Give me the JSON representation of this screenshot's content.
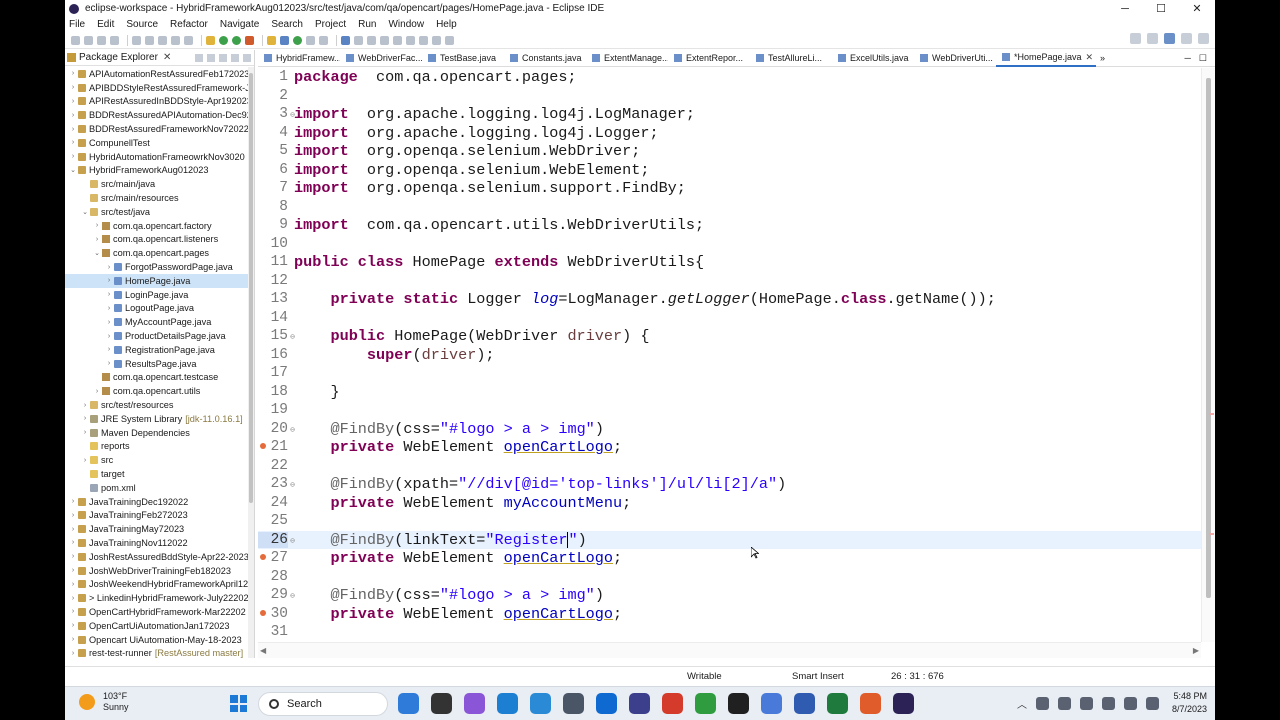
{
  "window": {
    "title": "eclipse-workspace - HybridFrameworkAug012023/src/test/java/com/qa/opencart/pages/HomePage.java - Eclipse IDE",
    "minimize": "─",
    "maximize": "☐",
    "close": "✕"
  },
  "menu": [
    "File",
    "Edit",
    "Source",
    "Refactor",
    "Navigate",
    "Search",
    "Project",
    "Run",
    "Window",
    "Help"
  ],
  "package_explorer": {
    "title": "Package Explorer",
    "items": [
      {
        "label": "APIAutomationRestAssuredFeb172023",
        "depth": 0,
        "icon": "proj",
        "tw": "›"
      },
      {
        "label": "APIBDDStyleRestAssuredFramework-Ju",
        "depth": 0,
        "icon": "proj",
        "tw": "›"
      },
      {
        "label": "APIRestAssuredInBDDStyle-Apr192023",
        "depth": 0,
        "icon": "proj",
        "tw": "›"
      },
      {
        "label": "BDDRestAssuredAPIAutomation-Dec92",
        "depth": 0,
        "icon": "proj",
        "tw": "›"
      },
      {
        "label": "BDDRestAssuredFrameworkNov72022",
        "depth": 0,
        "icon": "proj",
        "tw": "›"
      },
      {
        "label": "CompunellTest",
        "depth": 0,
        "icon": "proj",
        "tw": "›"
      },
      {
        "label": "HybridAutomationFrameowrkNov3020",
        "depth": 0,
        "icon": "proj",
        "tw": "›"
      },
      {
        "label": "HybridFrameworkAug012023",
        "depth": 0,
        "icon": "proj",
        "tw": "⌄"
      },
      {
        "label": "src/main/java",
        "depth": 1,
        "icon": "src",
        "tw": ""
      },
      {
        "label": "src/main/resources",
        "depth": 1,
        "icon": "src",
        "tw": ""
      },
      {
        "label": "src/test/java",
        "depth": 1,
        "icon": "src",
        "tw": "⌄"
      },
      {
        "label": "com.qa.opencart.factory",
        "depth": 2,
        "icon": "pkg",
        "tw": "›"
      },
      {
        "label": "com.qa.opencart.listeners",
        "depth": 2,
        "icon": "pkg",
        "tw": "›"
      },
      {
        "label": "com.qa.opencart.pages",
        "depth": 2,
        "icon": "pkg",
        "tw": "⌄"
      },
      {
        "label": "ForgotPasswordPage.java",
        "depth": 3,
        "icon": "java",
        "tw": "›"
      },
      {
        "label": "HomePage.java",
        "depth": 3,
        "icon": "java",
        "tw": "›",
        "selected": true
      },
      {
        "label": "LoginPage.java",
        "depth": 3,
        "icon": "java",
        "tw": "›"
      },
      {
        "label": "LogoutPage.java",
        "depth": 3,
        "icon": "java",
        "tw": "›"
      },
      {
        "label": "MyAccountPage.java",
        "depth": 3,
        "icon": "java",
        "tw": "›"
      },
      {
        "label": "ProductDetailsPage.java",
        "depth": 3,
        "icon": "java",
        "tw": "›"
      },
      {
        "label": "RegistrationPage.java",
        "depth": 3,
        "icon": "java",
        "tw": "›"
      },
      {
        "label": "ResultsPage.java",
        "depth": 3,
        "icon": "java",
        "tw": "›"
      },
      {
        "label": "com.qa.opencart.testcase",
        "depth": 2,
        "icon": "pkg",
        "tw": ""
      },
      {
        "label": "com.qa.opencart.utils",
        "depth": 2,
        "icon": "pkg",
        "tw": "›"
      },
      {
        "label": "src/test/resources",
        "depth": 1,
        "icon": "src",
        "tw": "›"
      },
      {
        "label": "JRE System Library",
        "depth": 1,
        "icon": "lib",
        "tw": "›",
        "decoration": "[jdk-11.0.16.1]"
      },
      {
        "label": "Maven Dependencies",
        "depth": 1,
        "icon": "lib",
        "tw": "›"
      },
      {
        "label": "reports",
        "depth": 1,
        "icon": "folder",
        "tw": ""
      },
      {
        "label": "src",
        "depth": 1,
        "icon": "folder",
        "tw": "›"
      },
      {
        "label": "target",
        "depth": 1,
        "icon": "folder",
        "tw": ""
      },
      {
        "label": "pom.xml",
        "depth": 1,
        "icon": "file",
        "tw": ""
      },
      {
        "label": "JavaTrainingDec192022",
        "depth": 0,
        "icon": "proj",
        "tw": "›"
      },
      {
        "label": "JavaTrainingFeb272023",
        "depth": 0,
        "icon": "proj",
        "tw": "›"
      },
      {
        "label": "JavaTrainingMay72023",
        "depth": 0,
        "icon": "proj",
        "tw": "›"
      },
      {
        "label": "JavaTrainingNov112022",
        "depth": 0,
        "icon": "proj",
        "tw": "›"
      },
      {
        "label": "JoshRestAssuredBddStyle-Apr22-2023",
        "depth": 0,
        "icon": "proj",
        "tw": "›"
      },
      {
        "label": "JoshWebDriverTrainingFeb182023",
        "depth": 0,
        "icon": "proj",
        "tw": "›"
      },
      {
        "label": "JoshWeekendHybridFrameworkApril12",
        "depth": 0,
        "icon": "proj",
        "tw": "›"
      },
      {
        "label": "> LinkedinHybridFramework-July22202",
        "depth": 0,
        "icon": "proj",
        "tw": "›"
      },
      {
        "label": "OpenCartHybridFramework-Mar22202",
        "depth": 0,
        "icon": "proj",
        "tw": "›"
      },
      {
        "label": "OpenCartUiAutomationJan172023",
        "depth": 0,
        "icon": "proj",
        "tw": "›"
      },
      {
        "label": "Opencart UiAutomation-May-18-2023",
        "depth": 0,
        "icon": "proj",
        "tw": "›"
      },
      {
        "label": "rest-test-runner",
        "depth": 0,
        "icon": "proj",
        "tw": "›",
        "decoration": "[RestAssured master]"
      }
    ]
  },
  "editor_tabs": [
    {
      "label": "HybridFramew...",
      "active": false
    },
    {
      "label": "WebDriverFac...",
      "active": false
    },
    {
      "label": "TestBase.java",
      "active": false
    },
    {
      "label": "Constants.java",
      "active": false
    },
    {
      "label": "ExtentManage...",
      "active": false
    },
    {
      "label": "ExtentRepor...",
      "active": false
    },
    {
      "label": "TestAllureLi...",
      "active": false
    },
    {
      "label": "ExcelUtils.java",
      "active": false
    },
    {
      "label": "WebDriverUti...",
      "active": false
    },
    {
      "label": "*HomePage.java",
      "active": true
    }
  ],
  "tab_overflow": "»",
  "code_lines": [
    {
      "n": "1",
      "tokens": [
        [
          "kw",
          "package"
        ],
        [
          "",
          "  com.qa.opencart.pages;"
        ]
      ]
    },
    {
      "n": "2",
      "tokens": []
    },
    {
      "n": "3",
      "fold": "⊖",
      "tokens": [
        [
          "kw",
          "import"
        ],
        [
          "",
          "  org.apache.logging.log4j.LogManager;"
        ]
      ]
    },
    {
      "n": "4",
      "tokens": [
        [
          "kw",
          "import"
        ],
        [
          "",
          "  org.apache.logging.log4j.Logger;"
        ]
      ]
    },
    {
      "n": "5",
      "tokens": [
        [
          "kw",
          "import"
        ],
        [
          "",
          "  org.openqa.selenium.WebDriver;"
        ]
      ]
    },
    {
      "n": "6",
      "tokens": [
        [
          "kw",
          "import"
        ],
        [
          "",
          "  org.openqa.selenium.WebElement;"
        ]
      ]
    },
    {
      "n": "7",
      "tokens": [
        [
          "kw",
          "import"
        ],
        [
          "",
          "  org.openqa.selenium.support.FindBy;"
        ]
      ]
    },
    {
      "n": "8",
      "tokens": []
    },
    {
      "n": "9",
      "tokens": [
        [
          "kw",
          "import"
        ],
        [
          "",
          "  com.qa.opencart.utils.WebDriverUtils;"
        ]
      ]
    },
    {
      "n": "10",
      "tokens": []
    },
    {
      "n": "11",
      "tokens": [
        [
          "kw",
          "public class"
        ],
        [
          "",
          " HomePage "
        ],
        [
          "kw",
          "extends"
        ],
        [
          "",
          " WebDriverUtils{"
        ]
      ]
    },
    {
      "n": "12",
      "tokens": []
    },
    {
      "n": "13",
      "tokens": [
        [
          "",
          "    "
        ],
        [
          "kw",
          "private static"
        ],
        [
          "",
          " Logger "
        ],
        [
          "fld2 ital",
          "log"
        ],
        [
          "",
          "=LogManager."
        ],
        [
          "ital",
          "getLogger"
        ],
        [
          "",
          "(HomePage."
        ],
        [
          "kw",
          "class"
        ],
        [
          "",
          ".getName());"
        ]
      ]
    },
    {
      "n": "14",
      "tokens": []
    },
    {
      "n": "15",
      "fold": "⊖",
      "tokens": [
        [
          "",
          "    "
        ],
        [
          "kw",
          "public"
        ],
        [
          "",
          " HomePage(WebDriver "
        ],
        [
          "param",
          "driver"
        ],
        [
          "",
          ") {"
        ]
      ]
    },
    {
      "n": "16",
      "tokens": [
        [
          "",
          "        "
        ],
        [
          "kw",
          "super"
        ],
        [
          "",
          "("
        ],
        [
          "param",
          "driver"
        ],
        [
          "",
          ");"
        ]
      ]
    },
    {
      "n": "17",
      "tokens": []
    },
    {
      "n": "18",
      "tokens": [
        [
          "",
          "    }"
        ]
      ]
    },
    {
      "n": "19",
      "tokens": []
    },
    {
      "n": "20",
      "fold": "⊖",
      "tokens": [
        [
          "",
          "    "
        ],
        [
          "ann",
          "@FindBy"
        ],
        [
          "",
          "(css="
        ],
        [
          "str",
          "\"#logo > a > img\""
        ],
        [
          "",
          ")"
        ]
      ]
    },
    {
      "n": "21",
      "err": true,
      "tokens": [
        [
          "",
          "    "
        ],
        [
          "kw",
          "private"
        ],
        [
          "",
          " WebElement "
        ],
        [
          "fld",
          "openCartLogo"
        ],
        [
          "",
          ";"
        ]
      ]
    },
    {
      "n": "22",
      "tokens": []
    },
    {
      "n": "23",
      "fold": "⊖",
      "tokens": [
        [
          "",
          "    "
        ],
        [
          "ann",
          "@FindBy"
        ],
        [
          "",
          "(xpath="
        ],
        [
          "str",
          "\"//div[@id='top-links']/ul/li[2]/a\""
        ],
        [
          "",
          ")"
        ]
      ]
    },
    {
      "n": "24",
      "tokens": [
        [
          "",
          "    "
        ],
        [
          "kw",
          "private"
        ],
        [
          "",
          " WebElement "
        ],
        [
          "fld2",
          "myAccountMenu"
        ],
        [
          "",
          ";"
        ]
      ]
    },
    {
      "n": "25",
      "tokens": []
    },
    {
      "n": "26",
      "current": true,
      "fold": "⊖",
      "tokens": [
        [
          "",
          "    "
        ],
        [
          "ann",
          "@FindBy"
        ],
        [
          "",
          "(linkText="
        ],
        [
          "str",
          "\"Register"
        ],
        [
          "caret",
          ""
        ],
        [
          "str",
          "\""
        ],
        [
          "",
          ")"
        ]
      ]
    },
    {
      "n": "27",
      "err": true,
      "tokens": [
        [
          "",
          "    "
        ],
        [
          "kw",
          "private"
        ],
        [
          "",
          " WebElement "
        ],
        [
          "fld",
          "openCartLogo"
        ],
        [
          "",
          ";"
        ]
      ]
    },
    {
      "n": "28",
      "tokens": []
    },
    {
      "n": "29",
      "fold": "⊖",
      "tokens": [
        [
          "",
          "    "
        ],
        [
          "ann",
          "@FindBy"
        ],
        [
          "",
          "(css="
        ],
        [
          "str",
          "\"#logo > a > img\""
        ],
        [
          "",
          ")"
        ]
      ]
    },
    {
      "n": "30",
      "err": true,
      "tokens": [
        [
          "",
          "    "
        ],
        [
          "kw",
          "private"
        ],
        [
          "",
          " WebElement "
        ],
        [
          "fld",
          "openCartLogo"
        ],
        [
          "",
          ";"
        ]
      ]
    },
    {
      "n": "31",
      "tokens": []
    },
    {
      "n": "32",
      "tokens": []
    }
  ],
  "status": {
    "mode": "Writable",
    "insert": "Smart Insert",
    "position": "26 : 31 : 676"
  },
  "taskbar": {
    "weather_temp": "103°F",
    "weather_desc": "Sunny",
    "search_label": "Search",
    "time": "5:48 PM",
    "date": "8/7/2023",
    "app_colors": [
      "#2e7bd9",
      "#333333",
      "#8a55d6",
      "#1d7fd2",
      "#2b8ad6",
      "#4a5565",
      "#0e6ad1",
      "#3b3f8c",
      "#d43b2a",
      "#2f9d3f",
      "#202020",
      "#4a7ad9",
      "#2f5bb0",
      "#1f7a3e",
      "#e05c2a",
      "#2c2255"
    ]
  }
}
